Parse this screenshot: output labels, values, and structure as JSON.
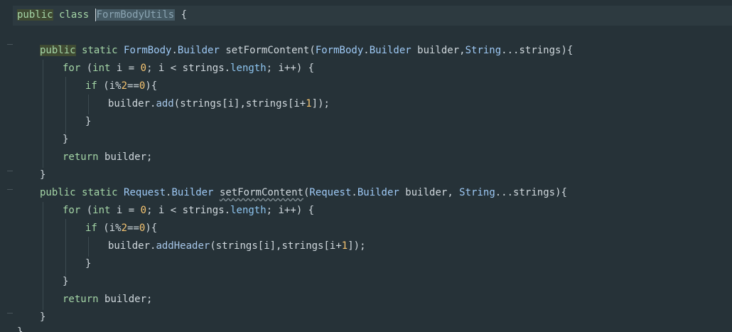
{
  "editor": {
    "lines": [
      {
        "id": "l1",
        "tokens": [
          "public",
          "class",
          "FormBodyUtils",
          "{"
        ]
      },
      {
        "id": "l3",
        "text": "public static FormBody.Builder setFormContent(FormBody.Builder builder,String...strings){"
      },
      {
        "id": "l4",
        "text": "for (int i = 0; i < strings.length; i++) {"
      },
      {
        "id": "l5",
        "text": "if (i%2==0){"
      },
      {
        "id": "l6",
        "text": "builder.add(strings[i],strings[i+1]);"
      },
      {
        "id": "l7",
        "text": "}"
      },
      {
        "id": "l8",
        "text": "}"
      },
      {
        "id": "l9",
        "text": "return builder;"
      },
      {
        "id": "l10",
        "text": "}"
      },
      {
        "id": "l11",
        "text": "public static Request.Builder setFormContent(Request.Builder builder, String...strings){"
      },
      {
        "id": "l12",
        "text": "for (int i = 0; i < strings.length; i++) {"
      },
      {
        "id": "l13",
        "text": "if (i%2==0){"
      },
      {
        "id": "l14",
        "text": "builder.addHeader(strings[i],strings[i+1]);"
      },
      {
        "id": "l15",
        "text": "}"
      },
      {
        "id": "l16",
        "text": "}"
      },
      {
        "id": "l17",
        "text": "return builder;"
      },
      {
        "id": "l18",
        "text": "}"
      },
      {
        "id": "l19",
        "text": "}"
      }
    ],
    "t": {
      "public": "public",
      "class": "class",
      "static": "static",
      "for": "for",
      "int": "int",
      "if": "if",
      "return": "return",
      "class_name": "FormBodyUtils",
      "open_brace": "{",
      "close_brace": "}",
      "formbody": "FormBody",
      "builder_type": "Builder",
      "request": "Request",
      "method_name": "setFormContent",
      "string": "String",
      "builder": "builder",
      "strings": "strings",
      "length": "length",
      "add": "add",
      "addHeader": "addHeader",
      "zero": "0",
      "two": "2",
      "one": "1"
    }
  }
}
